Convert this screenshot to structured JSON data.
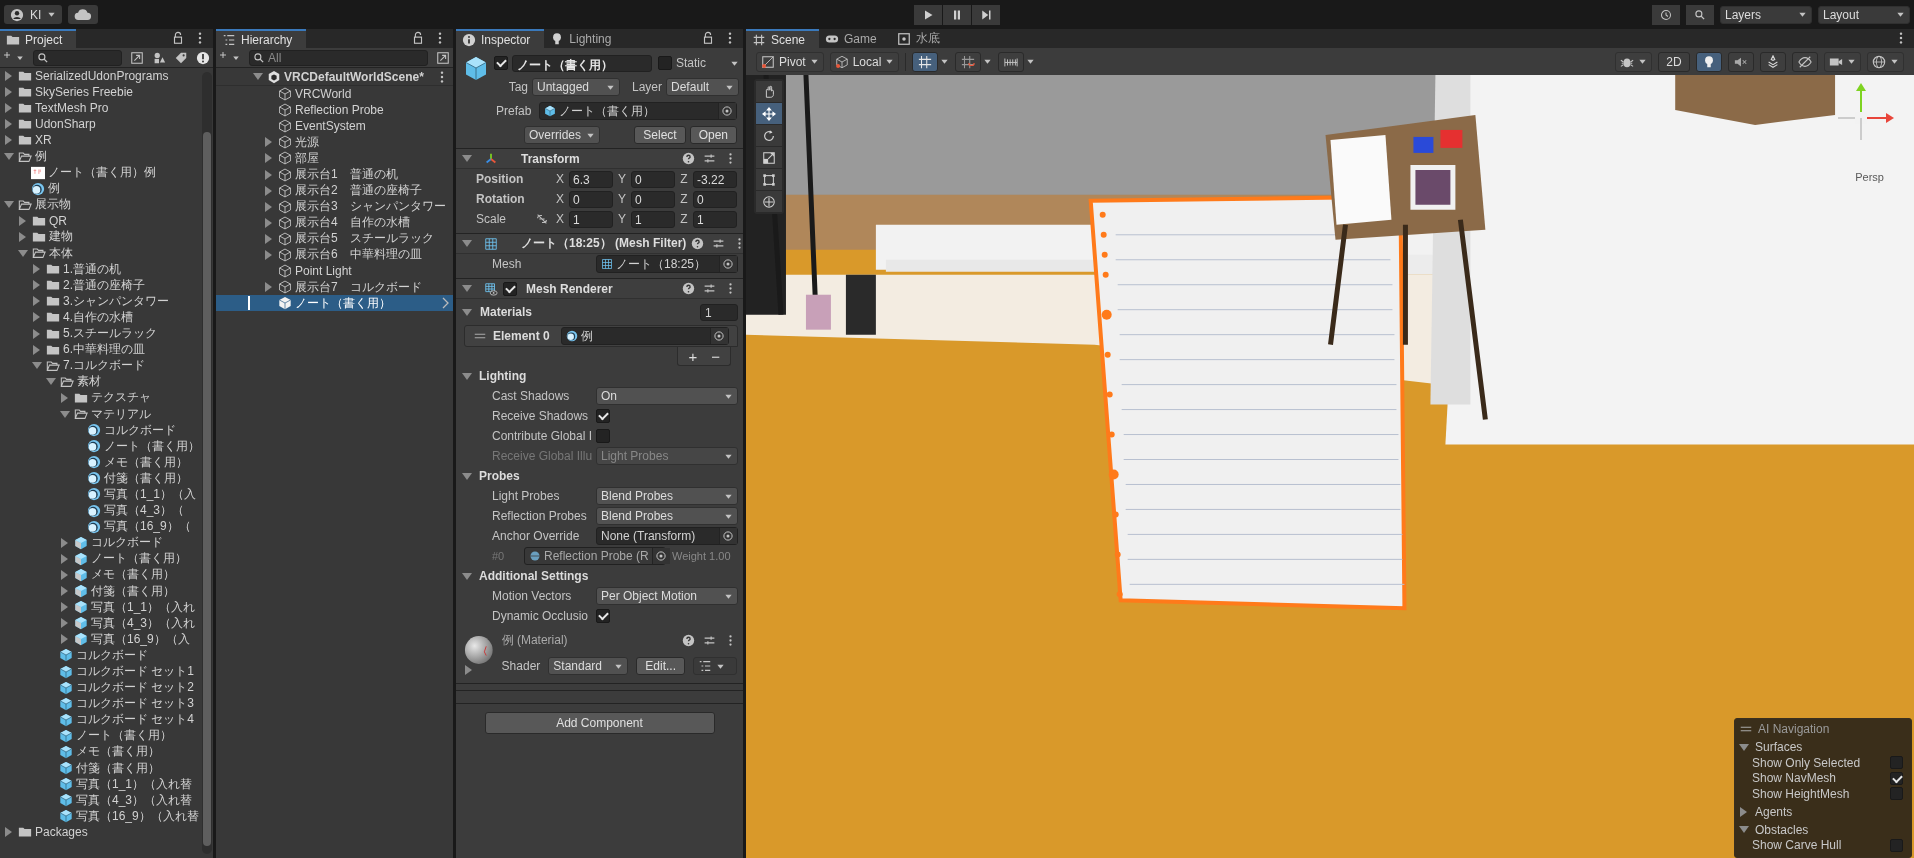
{
  "top_bar": {
    "account": "KI",
    "layers": "Layers",
    "layout": "Layout"
  },
  "project": {
    "tab": "Project",
    "tree": [
      {
        "label": "SerializedUdonPrograms",
        "kind": "folder",
        "expanded": false
      },
      {
        "label": "SkySeries Freebie",
        "kind": "folder",
        "expanded": false
      },
      {
        "label": "TextMesh Pro",
        "kind": "folder",
        "expanded": false
      },
      {
        "label": "UdonSharp",
        "kind": "folder",
        "expanded": false
      },
      {
        "label": "XR",
        "kind": "folder",
        "expanded": false
      },
      {
        "label": "例",
        "kind": "folder",
        "expanded": true,
        "children": [
          {
            "label": "ノート（書く用）例",
            "kind": "texture"
          },
          {
            "label": "例",
            "kind": "material"
          }
        ]
      },
      {
        "label": "展示物",
        "kind": "folder",
        "expanded": true,
        "children": [
          {
            "label": "QR",
            "kind": "folder",
            "expanded": false
          },
          {
            "label": "建物",
            "kind": "folder",
            "expanded": false
          },
          {
            "label": "本体",
            "kind": "folder",
            "expanded": true,
            "children": [
              {
                "label": "1.普通の机",
                "kind": "folder",
                "expanded": false
              },
              {
                "label": "2.普通の座椅子",
                "kind": "folder",
                "expanded": false
              },
              {
                "label": "3.シャンパンタワー",
                "kind": "folder",
                "expanded": false
              },
              {
                "label": "4.自作の水槽",
                "kind": "folder",
                "expanded": false
              },
              {
                "label": "5.スチールラック",
                "kind": "folder",
                "expanded": false
              },
              {
                "label": "6.中華料理の皿",
                "kind": "folder",
                "expanded": false
              },
              {
                "label": "7.コルクボード",
                "kind": "folder",
                "expanded": true,
                "children": [
                  {
                    "label": "素材",
                    "kind": "folder",
                    "expanded": true,
                    "children": [
                      {
                        "label": "テクスチャ",
                        "kind": "folder",
                        "expanded": false
                      },
                      {
                        "label": "マテリアル",
                        "kind": "folder",
                        "expanded": true,
                        "children": [
                          {
                            "label": "コルクボード",
                            "kind": "material"
                          },
                          {
                            "label": "ノート（書く用）",
                            "kind": "material"
                          },
                          {
                            "label": "メモ（書く用）",
                            "kind": "material"
                          },
                          {
                            "label": "付箋（書く用）",
                            "kind": "material"
                          },
                          {
                            "label": "写真（1_1）（入",
                            "kind": "material"
                          },
                          {
                            "label": "写真（4_3）（",
                            "kind": "material"
                          },
                          {
                            "label": "写真（16_9）（",
                            "kind": "material"
                          }
                        ]
                      },
                      {
                        "label": "コルクボード",
                        "kind": "model",
                        "expanded": false
                      },
                      {
                        "label": "ノート（書く用）",
                        "kind": "model",
                        "expanded": false
                      },
                      {
                        "label": "メモ（書く用）",
                        "kind": "model",
                        "expanded": false
                      },
                      {
                        "label": "付箋（書く用）",
                        "kind": "model",
                        "expanded": false
                      },
                      {
                        "label": "写真（1_1）（入れ",
                        "kind": "model",
                        "expanded": false
                      },
                      {
                        "label": "写真（4_3）（入れ",
                        "kind": "model",
                        "expanded": false
                      },
                      {
                        "label": "写真（16_9）（入",
                        "kind": "model",
                        "expanded": false
                      }
                    ]
                  },
                  {
                    "label": "コルクボード",
                    "kind": "prefab"
                  },
                  {
                    "label": "コルクボード セット1",
                    "kind": "prefab"
                  },
                  {
                    "label": "コルクボード セット2",
                    "kind": "prefab"
                  },
                  {
                    "label": "コルクボード セット3",
                    "kind": "prefab"
                  },
                  {
                    "label": "コルクボード セット4",
                    "kind": "prefab"
                  },
                  {
                    "label": "ノート（書く用）",
                    "kind": "prefab"
                  },
                  {
                    "label": "メモ（書く用）",
                    "kind": "prefab"
                  },
                  {
                    "label": "付箋（書く用）",
                    "kind": "prefab"
                  },
                  {
                    "label": "写真（1_1）（入れ替",
                    "kind": "prefab"
                  },
                  {
                    "label": "写真（4_3）（入れ替",
                    "kind": "prefab"
                  },
                  {
                    "label": "写真（16_9）（入れ替",
                    "kind": "prefab"
                  }
                ]
              }
            ]
          }
        ]
      },
      {
        "label": "Packages",
        "kind": "folder",
        "expanded": false
      }
    ]
  },
  "hierarchy": {
    "tab": "Hierarchy",
    "search_placeholder": "All",
    "scene": {
      "label": "VRCDefaultWorldScene*",
      "expanded": true,
      "children": [
        {
          "label": "VRCWorld",
          "kind": "object",
          "selected": false
        },
        {
          "label": "Reflection Probe",
          "kind": "object",
          "selected": false
        },
        {
          "label": "EventSystem",
          "kind": "object",
          "selected": false
        },
        {
          "label": "光源",
          "kind": "object",
          "expanded": false,
          "selected": false
        },
        {
          "label": "部屋",
          "kind": "object",
          "expanded": false,
          "selected": false
        },
        {
          "label": "展示台1　普通の机",
          "kind": "object",
          "expanded": false,
          "selected": false
        },
        {
          "label": "展示台2　普通の座椅子",
          "kind": "object",
          "expanded": false,
          "selected": false
        },
        {
          "label": "展示台3　シャンパンタワー",
          "kind": "object",
          "expanded": false,
          "selected": false
        },
        {
          "label": "展示台4　自作の水槽",
          "kind": "object",
          "expanded": false,
          "selected": false
        },
        {
          "label": "展示台5　スチールラック",
          "kind": "object",
          "expanded": false,
          "selected": false
        },
        {
          "label": "展示台6　中華料理の皿",
          "kind": "object",
          "expanded": false,
          "selected": false
        },
        {
          "label": "Point Light",
          "kind": "object",
          "selected": false
        },
        {
          "label": "展示台7　コルクボード",
          "kind": "object",
          "expanded": false,
          "selected": false
        },
        {
          "label": "ノート（書く用）",
          "kind": "prefab",
          "selected": true
        }
      ]
    }
  },
  "inspector": {
    "tabs": [
      {
        "label": "Inspector",
        "kind": "info",
        "selected": true
      },
      {
        "label": "Lighting",
        "kind": "light",
        "selected": false
      }
    ],
    "object": {
      "active": true,
      "name": "ノート（書く用）",
      "static": false,
      "static_label": "Static",
      "tag_label": "Tag",
      "tag": "Untagged",
      "layer_label": "Layer",
      "layer": "Default",
      "prefab_label": "Prefab",
      "prefab": "ノート（書く用）",
      "overrides": "Overrides",
      "buttons": [
        "Select",
        "Open"
      ]
    },
    "components": [
      {
        "kind": "transform",
        "title": "Transform",
        "expanded": true,
        "rows": [
          {
            "label": "Position",
            "overridden": true,
            "values": [
              {
                "axis": "X",
                "value": "6.3"
              },
              {
                "axis": "Y",
                "value": "0"
              },
              {
                "axis": "Z",
                "value": "-3.22"
              }
            ]
          },
          {
            "label": "Rotation",
            "overridden": true,
            "values": [
              {
                "axis": "X",
                "value": "0"
              },
              {
                "axis": "Y",
                "value": "0"
              },
              {
                "axis": "Z",
                "value": "0"
              }
            ]
          },
          {
            "label": "Scale",
            "overridden": false,
            "linked": false,
            "values": [
              {
                "axis": "X",
                "value": "1"
              },
              {
                "axis": "Y",
                "value": "1"
              },
              {
                "axis": "Z",
                "value": "1"
              }
            ]
          }
        ]
      },
      {
        "kind": "mesh_filter",
        "title": "ノート（18:25） (Mesh Filter)",
        "expanded": true,
        "rows": [
          {
            "kind": "object",
            "label": "Mesh",
            "value": "ノート（18:25）"
          }
        ]
      },
      {
        "kind": "mesh_renderer",
        "title": "Mesh Renderer",
        "enabled": true,
        "expanded": true,
        "rows": [
          {
            "kind": "array",
            "label": "Materials",
            "expanded": true,
            "value": "1"
          },
          {
            "kind": "element",
            "label": "Element 0",
            "value": "例"
          },
          {
            "kind": "add_remove",
            "buttons": [
              "+",
              "−"
            ]
          },
          {
            "kind": "section",
            "label": "Lighting",
            "expanded": true
          },
          {
            "kind": "dropdown",
            "label": "Cast Shadows",
            "value": "On",
            "disabled": false
          },
          {
            "kind": "checkbox",
            "label": "Receive Shadows",
            "checked": true
          },
          {
            "kind": "checkbox",
            "label": "Contribute Global I",
            "checked": false
          },
          {
            "kind": "dropdown",
            "label": "Receive Global Illu",
            "value": "Light Probes",
            "disabled": true
          },
          {
            "kind": "section",
            "label": "Probes",
            "expanded": true
          },
          {
            "kind": "dropdown",
            "label": "Light Probes",
            "value": "Blend Probes",
            "disabled": false
          },
          {
            "kind": "dropdown",
            "label": "Reflection Probes",
            "value": "Blend Probes",
            "disabled": false
          },
          {
            "kind": "object",
            "label": "Anchor Override",
            "value": "None (Transform)"
          },
          {
            "kind": "probe",
            "label": "#0",
            "value": "Reflection Probe (R",
            "weight": "Weight 1.00"
          },
          {
            "kind": "section",
            "label": "Additional Settings",
            "expanded": true
          },
          {
            "kind": "dropdown",
            "label": "Motion Vectors",
            "value": "Per Object Motion",
            "disabled": false
          },
          {
            "kind": "checkbox",
            "label": "Dynamic Occlusio",
            "checked": true
          }
        ]
      },
      {
        "kind": "material",
        "title": "例 (Material)",
        "expanded": false,
        "shader_label": "Shader",
        "shader": "Standard",
        "edit": "Edit..."
      }
    ],
    "add_component": "Add Component"
  },
  "scene": {
    "tabs": [
      {
        "label": "Scene",
        "kind": "scene",
        "selected": true
      },
      {
        "label": "Game",
        "kind": "game",
        "selected": false
      },
      {
        "label": "水底",
        "kind": "custom",
        "selected": false
      }
    ],
    "pivot": "Pivot",
    "space": "Local",
    "left_toggles": [
      {
        "kind": "snap",
        "on": true
      },
      {
        "kind": "grid",
        "on": false
      },
      {
        "kind": "increment",
        "on": false
      }
    ],
    "mode_2d": {
      "label": "2D",
      "on": false
    },
    "right_toggles": [
      {
        "kind": "light",
        "on": true
      },
      {
        "kind": "audio",
        "on": false
      },
      {
        "kind": "effects",
        "on": false
      },
      {
        "kind": "visibility",
        "on": false
      }
    ],
    "tools": [
      {
        "kind": "hand",
        "selected": false
      },
      {
        "kind": "move",
        "selected": true
      },
      {
        "kind": "rotate",
        "selected": false
      },
      {
        "kind": "scale",
        "selected": false
      },
      {
        "kind": "rect",
        "selected": false
      },
      {
        "kind": "transform",
        "selected": false
      }
    ],
    "gizmo_label": "Persp",
    "ai_navigation": {
      "title": "AI Navigation",
      "sections": [
        {
          "label": "Surfaces",
          "expanded": true,
          "options": [
            {
              "label": "Show Only Selected",
              "checked": false
            },
            {
              "label": "Show NavMesh",
              "checked": true
            },
            {
              "label": "Show HeightMesh",
              "checked": false
            }
          ]
        },
        {
          "label": "Agents",
          "expanded": false
        },
        {
          "label": "Obstacles",
          "expanded": true,
          "options": [
            {
              "label": "Show Carve Hull",
              "checked": false
            }
          ]
        }
      ]
    }
  }
}
